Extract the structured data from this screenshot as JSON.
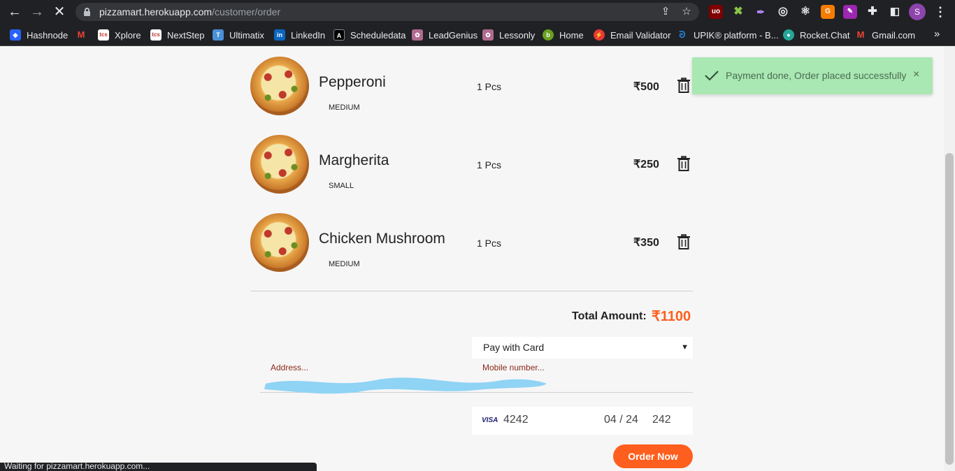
{
  "browser": {
    "url_host": "pizzamart.herokuapp.com",
    "url_path": "/customer/order",
    "profile_initial": "S",
    "status_text": "Waiting for pizzamart.herokuapp.com..."
  },
  "bookmarks": [
    {
      "label": "Hashnode",
      "icon": "hashnode-icon",
      "color": "#2962ff"
    },
    {
      "label": "",
      "icon": "gmail-icon",
      "color": "#ea4335"
    },
    {
      "label": "Xplore",
      "icon": "tcs-icon",
      "color": "#c0392b"
    },
    {
      "label": "NextStep",
      "icon": "tcs-icon",
      "color": "#c0392b"
    },
    {
      "label": "Ultimatix",
      "icon": "tata-icon",
      "color": "#4a90d9"
    },
    {
      "label": "LinkedIn",
      "icon": "linkedin-icon",
      "color": "#0a66c2"
    },
    {
      "label": "Scheduledata",
      "icon": "scheduledata-icon",
      "color": "#000000"
    },
    {
      "label": "LeadGenius",
      "icon": "leadgenius-icon",
      "color": "#b06a8f"
    },
    {
      "label": "Lessonly",
      "icon": "lessonly-icon",
      "color": "#b06a8f"
    },
    {
      "label": "Home",
      "icon": "home-icon",
      "color": "#6aa121"
    },
    {
      "label": "Email Validator",
      "icon": "email-validator-icon",
      "color": "#e53935"
    },
    {
      "label": "UPIK® platform - B...",
      "icon": "upik-icon",
      "color": "#1e88e5"
    },
    {
      "label": "Rocket.Chat",
      "icon": "rocketchat-icon",
      "color": "#26a69a"
    },
    {
      "label": "Gmail.com",
      "icon": "gmail-icon",
      "color": "#ea4335"
    }
  ],
  "order": {
    "items": [
      {
        "name": "Pepperoni",
        "size": "MEDIUM",
        "qty": "1 Pcs",
        "price": "₹500"
      },
      {
        "name": "Margherita",
        "size": "SMALL",
        "qty": "1 Pcs",
        "price": "₹250"
      },
      {
        "name": "Chicken Mushroom",
        "size": "MEDIUM",
        "qty": "1 Pcs",
        "price": "₹350"
      }
    ],
    "total_label": "Total Amount:",
    "total_value": "₹1100",
    "payment_method": "Pay with Card",
    "address_placeholder": "Address...",
    "mobile_placeholder": "Mobile number...",
    "card": {
      "brand": "VISA",
      "number": "4242",
      "expiry": "04 / 24",
      "cvc": "242"
    },
    "order_button": "Order Now"
  },
  "toast": {
    "message": "Payment done, Order placed successfully",
    "close": "×"
  },
  "colors": {
    "accent": "#fe5f1e",
    "toast_bg": "#a9e7b3"
  }
}
